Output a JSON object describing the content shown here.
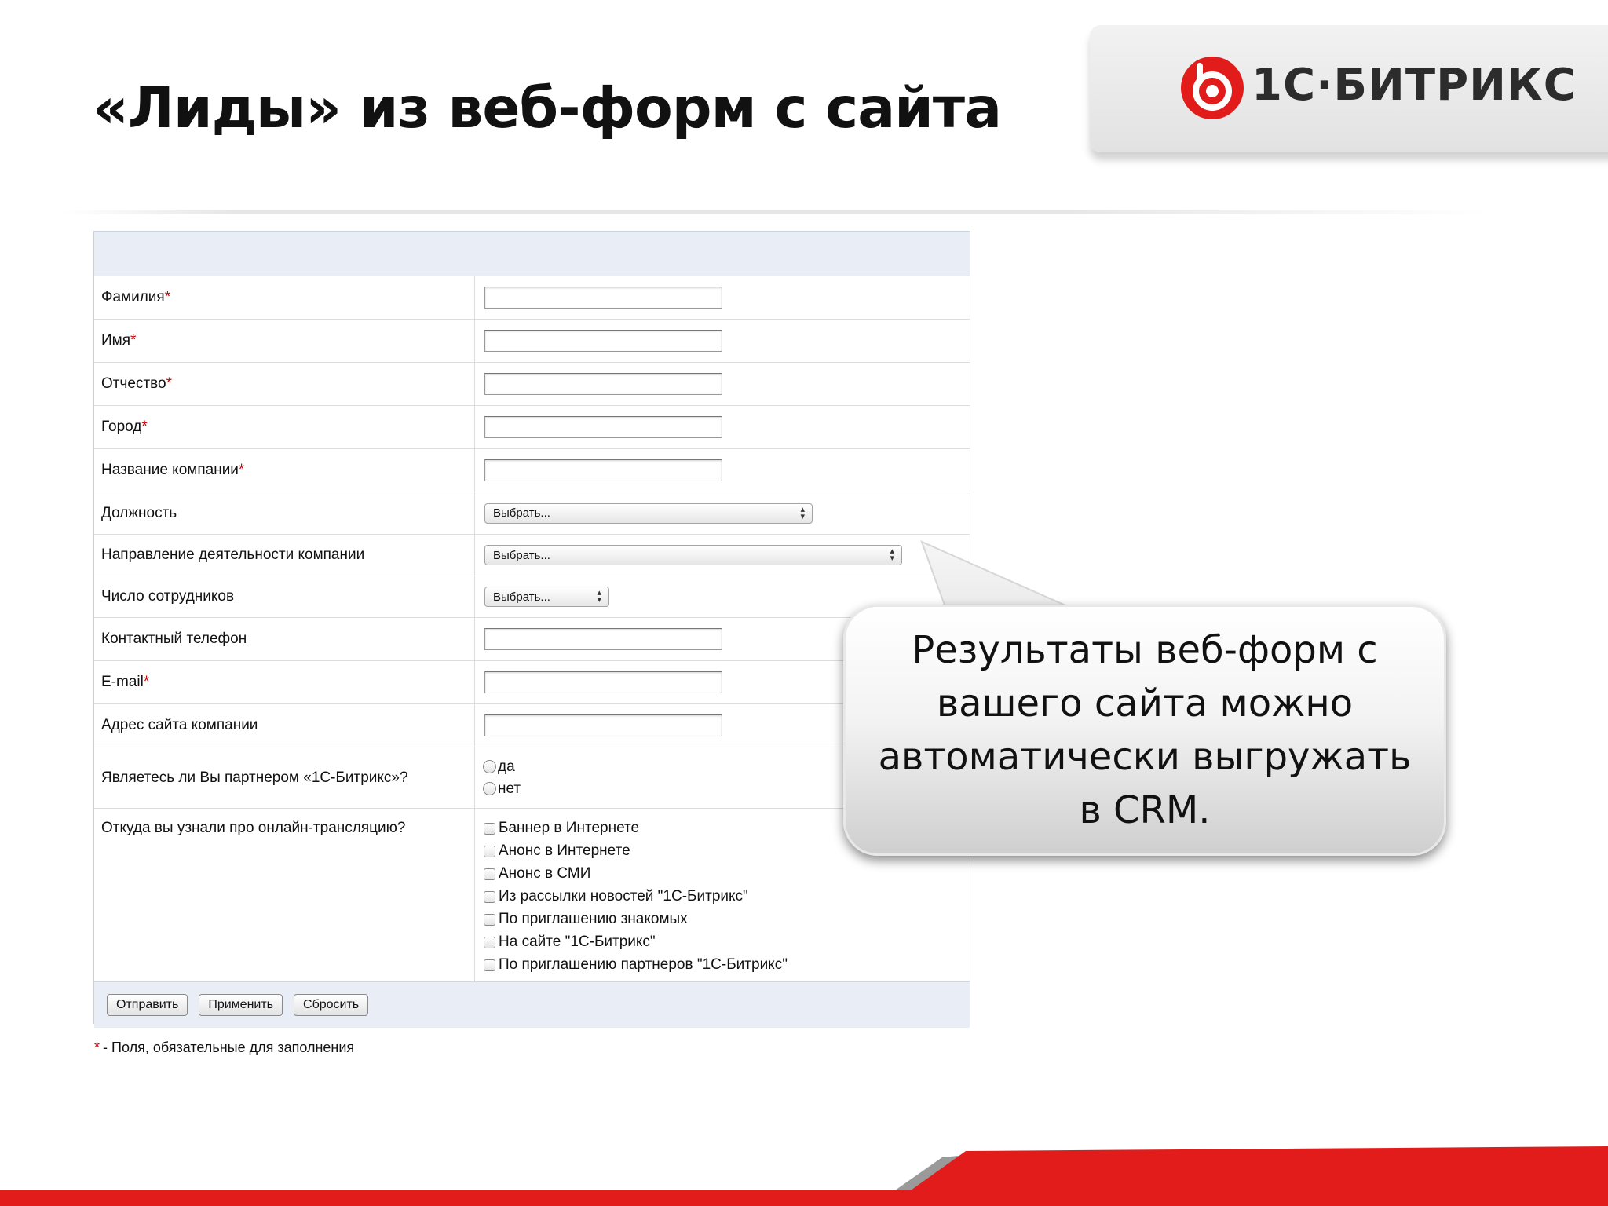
{
  "slide": {
    "title": "«Лиды» из веб-форм с сайта",
    "logo_text": "1С·БИТРИКС"
  },
  "form": {
    "fields": [
      {
        "label": "Фамилия",
        "required": "*",
        "type": "text"
      },
      {
        "label": "Имя",
        "required": "*",
        "type": "text"
      },
      {
        "label": "Отчество",
        "required": "*",
        "type": "text"
      },
      {
        "label": "Город",
        "required": "*",
        "type": "text"
      },
      {
        "label": "Название компании",
        "required": "*",
        "type": "text"
      },
      {
        "label": "Должность",
        "required": "",
        "type": "select",
        "value": "Выбрать..."
      },
      {
        "label": "Направление деятельности компании",
        "required": "",
        "type": "select",
        "value": "Выбрать..."
      },
      {
        "label": "Число сотрудников",
        "required": "",
        "type": "select",
        "value": "Выбрать..."
      },
      {
        "label": "Контактный телефон",
        "required": "",
        "type": "text"
      },
      {
        "label": "E-mail",
        "required": "*",
        "type": "text"
      },
      {
        "label": "Адрес сайта компании",
        "required": "",
        "type": "text"
      }
    ],
    "partner_question": {
      "label": "Являетесь ли Вы партнером «1С-Битрикс»?",
      "options": [
        "да",
        "нет"
      ]
    },
    "source_question": {
      "label": "Откуда вы узнали про онлайн-трансляцию?",
      "options": [
        "Баннер в Интернете",
        "Анонс в Интернете",
        "Анонс в СМИ",
        "Из рассылки новостей \"1С-Битрикс\"",
        "По приглашению знакомых",
        "На сайте \"1С-Битрикс\"",
        "По приглашению партнеров \"1С-Битрикс\""
      ]
    },
    "buttons": {
      "submit": "Отправить",
      "apply": "Применить",
      "reset": "Сбросить"
    },
    "required_note": {
      "marker": "*",
      "text": "- Поля, обязательные для заполнения"
    }
  },
  "callout": {
    "text": "Результаты веб-форм с вашего сайта можно автоматически выгружать в CRM."
  },
  "colors": {
    "brand_red": "#e21b1b",
    "required_red": "#cc0000",
    "form_header_bg": "#e9eef6"
  }
}
